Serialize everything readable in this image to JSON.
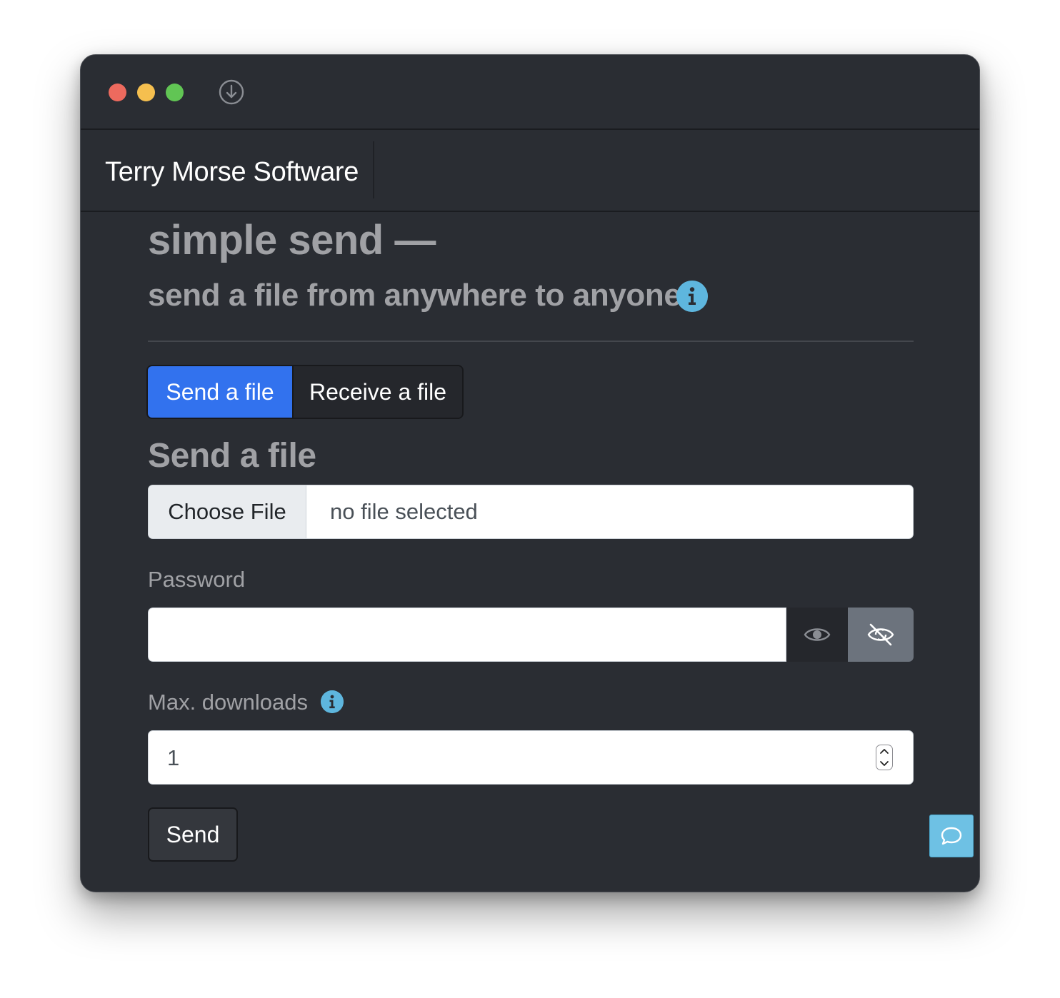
{
  "navbar": {
    "brand": "Terry Morse Software"
  },
  "header": {
    "title": "simple send —",
    "subtitle": "send a file from anywhere to anyone"
  },
  "tabs": [
    {
      "label": "Send a file",
      "active": true
    },
    {
      "label": "Receive a file",
      "active": false
    }
  ],
  "send_form": {
    "section_title": "Send a file",
    "file_button_label": "Choose File",
    "file_status": "no file selected",
    "password_label": "Password",
    "password_value": "",
    "max_downloads_label": "Max. downloads",
    "max_downloads_value": "1",
    "send_label": "Send"
  },
  "icons": {
    "title_bar": "download-circle-icon",
    "info": "info-icon",
    "show_password": "eye-icon",
    "hide_password": "eye-slash-icon",
    "chat": "chat-bubble-icon"
  },
  "colors": {
    "window_bg": "#2a2d33",
    "accent": "#3272ee",
    "info": "#5eb6de",
    "chat": "#6ec1e4",
    "muted_text": "#a0a1a5"
  }
}
